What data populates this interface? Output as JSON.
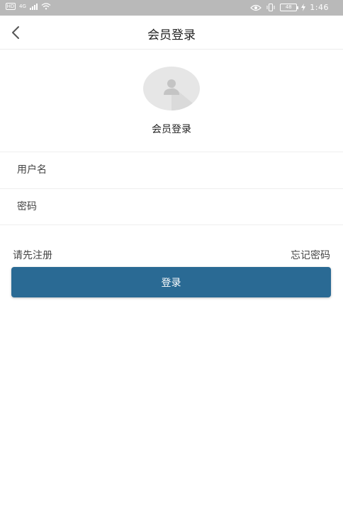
{
  "status_bar": {
    "sim_label": "HD",
    "network_label": "4G",
    "battery_label": "48",
    "time": "1:46"
  },
  "header": {
    "back_icon": "chevron-left-icon",
    "title": "会员登录"
  },
  "profile": {
    "avatar_icon": "user-silhouette-icon",
    "caption": "会员登录"
  },
  "form": {
    "username_placeholder": "用户名",
    "password_placeholder": "密码"
  },
  "links": {
    "register": "请先注册",
    "forgot_password": "忘记密码"
  },
  "login_button": {
    "label": "登录"
  },
  "colors": {
    "status_bar_bg": "#b9b9b9",
    "primary_button": "#2a6a94",
    "avatar_bg": "#e6e6e6"
  }
}
